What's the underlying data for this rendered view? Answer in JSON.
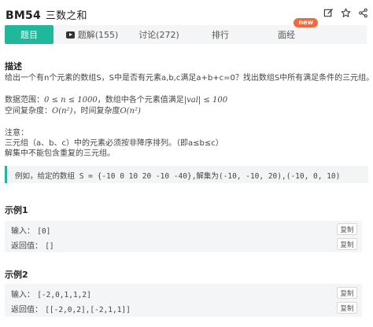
{
  "header": {
    "problem_id": "BM54",
    "problem_name": "三数之和",
    "icons": [
      "edit-icon",
      "star-icon",
      "share-icon"
    ]
  },
  "tabs": {
    "problem": "题目",
    "solution": "题解(155)",
    "discussion": "讨论(272)",
    "ranking": "排行",
    "solve": "面经",
    "new_badge": "new"
  },
  "description": {
    "heading": "描述",
    "line1": "给出一个有n个元素的数组S，S中是否有元素a,b,c满足a+b+c=0？找出数组S中所有满足条件的三元组。",
    "range_prefix": "数据范围：",
    "range_math": "0 ≤ n ≤ 1000",
    "range_mid": "，数组中各个元素值满足",
    "range_math2": "|val| ≤ 100",
    "complexity_prefix": "空间复杂度：",
    "complexity_space": "O(n²)",
    "complexity_mid": "，时间复杂度",
    "complexity_time": "O(n²)",
    "note_heading": "注意：",
    "note1": "三元组（a、b、c）中的元素必须按非降序排列。（即a≤b≤c）",
    "note2": "解集中不能包含重复的三元组。",
    "example_note": "例如，给定的数组 S = {-10 0 10 20 -10 -40},解集为(-10, -10, 20),(-10, 0, 10)"
  },
  "examples": [
    {
      "title": "示例1",
      "input_label": "输入：",
      "input_value": "[0]",
      "output_label": "返回值：",
      "output_value": "[]",
      "copy_label": "复制"
    },
    {
      "title": "示例2",
      "input_label": "输入：",
      "input_value": "[-2,0,1,1,2]",
      "output_label": "返回值：",
      "output_value": "[[-2,0,2],[-2,1,1]]",
      "copy_label": "复制"
    }
  ],
  "colors": {
    "accent": "#1fb89a",
    "badge": "#f06b3c",
    "panel": "#f4f5f7"
  }
}
